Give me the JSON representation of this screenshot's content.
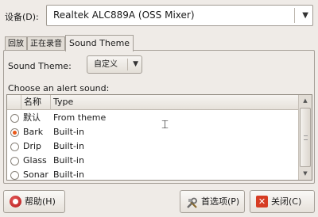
{
  "device": {
    "label": "设备(D):",
    "value": "Realtek ALC889A (OSS Mixer)"
  },
  "tabs": [
    "回放",
    "正在录音",
    "Sound Theme"
  ],
  "theme": {
    "label": "Sound Theme:",
    "value": "自定义"
  },
  "alerts": {
    "label": "Choose an alert sound:",
    "columns": [
      "名称",
      "Type"
    ],
    "rows": [
      {
        "name": "默认",
        "type": "From theme",
        "selected": false
      },
      {
        "name": "Bark",
        "type": "Built-in",
        "selected": true
      },
      {
        "name": "Drip",
        "type": "Built-in",
        "selected": false
      },
      {
        "name": "Glass",
        "type": "Built-in",
        "selected": false
      },
      {
        "name": "Sonar",
        "type": "Built-in",
        "selected": false
      }
    ]
  },
  "buttons": {
    "help": "帮助(H)",
    "preferences": "首选项(P)",
    "close": "关闭(C)"
  },
  "colors": {
    "radio_selected": "#e9581a",
    "close_icon": "#d63c23",
    "help_icon": "#b71d1d"
  }
}
